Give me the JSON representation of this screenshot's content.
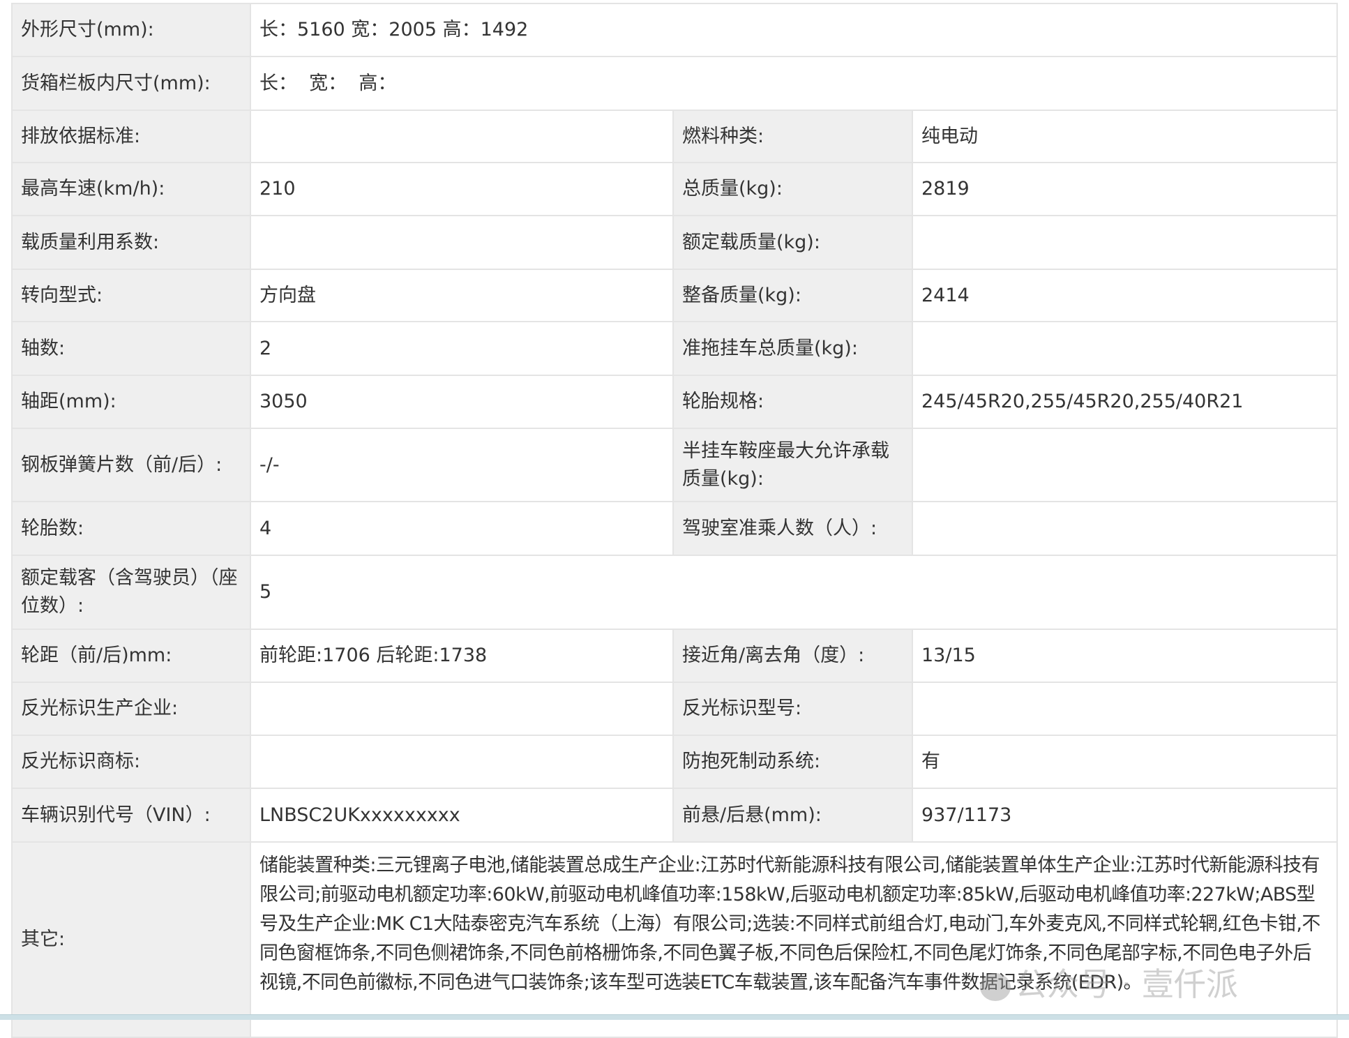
{
  "rows": [
    {
      "label": "外形尺寸(mm):",
      "value": "长：5160 宽：2005 高：1492"
    },
    {
      "label": "货箱栏板内尺寸(mm):",
      "value": "长：  宽：  高："
    },
    {
      "label": "排放依据标准:",
      "value": "",
      "label2": "燃料种类:",
      "value2": "纯电动"
    },
    {
      "label": "最高车速(km/h):",
      "value": "210",
      "label2": "总质量(kg):",
      "value2": "2819"
    },
    {
      "label": "载质量利用系数:",
      "value": "",
      "label2": "额定载质量(kg):",
      "value2": ""
    },
    {
      "label": "转向型式:",
      "value": "方向盘",
      "label2": "整备质量(kg):",
      "value2": "2414"
    },
    {
      "label": "轴数:",
      "value": "2",
      "label2": "准拖挂车总质量(kg):",
      "value2": ""
    },
    {
      "label": "轴距(mm):",
      "value": "3050",
      "label2": "轮胎规格:",
      "value2": "245/45R20,255/45R20,255/40R21"
    },
    {
      "label": "钢板弹簧片数（前/后）:",
      "value": "-/-",
      "label2": "半挂车鞍座最大允许承载质量(kg):",
      "value2": ""
    },
    {
      "label": "轮胎数:",
      "value": "4",
      "label2": "驾驶室准乘人数（人）:",
      "value2": ""
    },
    {
      "label": "额定载客（含驾驶员）（座位数）:",
      "value": "5"
    },
    {
      "label": "轮距（前/后)mm:",
      "value": "前轮距:1706 后轮距:1738",
      "label2": "接近角/离去角（度）:",
      "value2": "13/15"
    },
    {
      "label": "反光标识生产企业:",
      "value": "",
      "label2": "反光标识型号:",
      "value2": ""
    },
    {
      "label": "反光标识商标:",
      "value": "",
      "label2": "防抱死制动系统:",
      "value2": "有"
    },
    {
      "label": "车辆识别代号（VIN）:",
      "value": "LNBSC2UKxxxxxxxxx",
      "label2": "前悬/后悬(mm):",
      "value2": "937/1173"
    },
    {
      "label": "其它:",
      "value": "储能装置种类:三元锂离子电池,储能装置总成生产企业:江苏时代新能源科技有限公司,储能装置单体生产企业:江苏时代新能源科技有限公司;前驱动电机额定功率:60kW,前驱动电机峰值功率:158kW,后驱动电机额定功率:85kW,后驱动电机峰值功率:227kW;ABS型号及生产企业:MK C1大陆泰密克汽车系统（上海）有限公司;选装:不同样式前组合灯,电动门,车外麦克风,不同样式轮辋,红色卡钳,不同色窗框饰条,不同色侧裙饰条,不同色前格栅饰条,不同色翼子板,不同色后保险杠,不同色尾灯饰条,不同色尾部字标,不同色电子外后视镜,不同色前徽标,不同色进气口装饰条;该车型可选装ETC车载装置,该车配备汽车事件数据记录系统(EDR)。"
    }
  ],
  "watermark": "公众号 · 壹仟派"
}
